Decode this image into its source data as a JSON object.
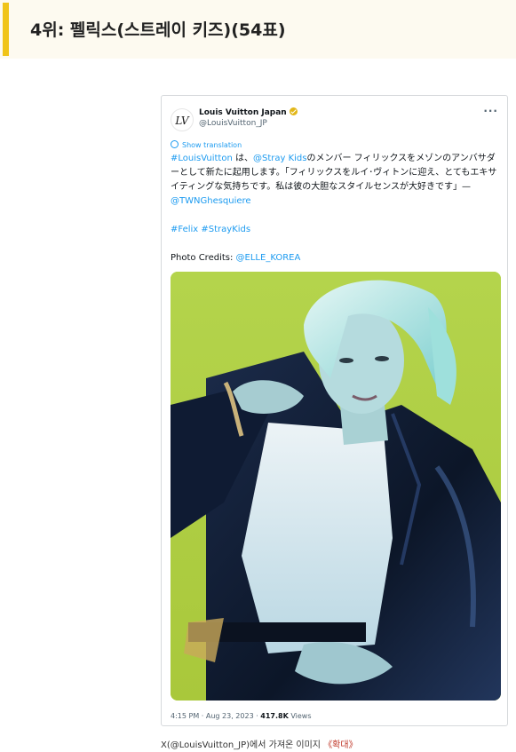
{
  "heading": {
    "title": "4위: 펠릭스(스트레이 키즈)(54표)",
    "accent_color": "#f0c419"
  },
  "tweet": {
    "avatar_icon": "louis-vuitton-logo-icon",
    "account_name": "Louis Vuitton Japan",
    "account_handle": "@LouisVuitton_JP",
    "more_icon": "more-options-icon",
    "show_translation": "Show translation",
    "hashtag_lv": "#LouisVuitton",
    "text_1": " は、",
    "mention_stray": "@Stray Kids",
    "text_2": "のメンバー フィリックスをメゾンのアンバサダーとして新たに起用します。「フィリックスをルイ･ヴィトンに迎え、とてもエキサイティングな気持ちです。私は彼の大胆なスタイルセンスが大好きです」—",
    "mention_twng": "@TWNGhesquiere",
    "hashtag_felix": "#Felix",
    "hashtag_straykids": "#StrayKids",
    "photo_credits_label": "Photo Credits: ",
    "mention_elle": "@ELLE_KOREA",
    "time": "4:15 PM · Aug 23, 2023 · ",
    "views_count": "417.8K",
    "views_label": " Views",
    "link_color": "#1d9bf0"
  },
  "caption": {
    "text": "X(@LouisVuitton_JP)에서 가져온 이미지 ",
    "expand_label": "《확대》"
  }
}
